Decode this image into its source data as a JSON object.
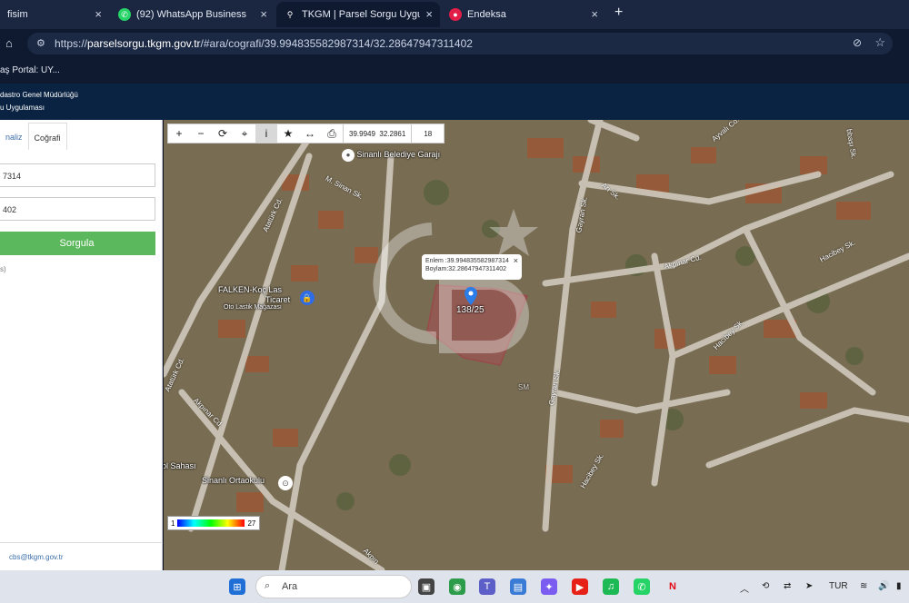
{
  "browser": {
    "tabs": [
      {
        "title": "fisim"
      },
      {
        "title": "(92) WhatsApp Business"
      },
      {
        "title": "TKGM | Parsel Sorgu Uygulamas"
      },
      {
        "title": "Endeksa"
      }
    ],
    "url_prefix": "https://",
    "url_host": "parselsorgu.tkgm.gov.tr",
    "url_path": "/#ara/cografi/39.994835582987314/32.28647947311402",
    "bookmark": "aş Portal: UY..."
  },
  "site": {
    "org": "dastro Genel Müdürlüğü",
    "app": "u Uygulaması"
  },
  "panel": {
    "tabs": [
      "naliz",
      "Coğrafi"
    ],
    "lat_value": "7314",
    "lon_value": "402",
    "query_label": "Sorgula",
    "small_note": "s)",
    "footer_email": "cbs@tkgm.gov.tr"
  },
  "map": {
    "toolbar": {
      "lat": "39.9949",
      "lon": "32.2861",
      "zoom": "18"
    },
    "popup_lat": "Enlem :39.994835582987314",
    "popup_lon": "Boylam:32.28647947311402",
    "parcel_label": "138/25",
    "poi": [
      {
        "name": "Sinanlı Belediye Garajı"
      },
      {
        "name": "FALKEN-Koç Las"
      },
      {
        "name": "Ticaret"
      },
      {
        "name": "Oto Lastik Mağazası"
      },
      {
        "name": "Sinanlı Ortaokulu"
      },
      {
        "name": "ol Sahası"
      }
    ],
    "roads": [
      "M. Sinan Sk.",
      "Atatürk Cd.",
      "Gayran Sk.",
      "Arı Sk.",
      "Ayvalı Cd.",
      "Akpınar Cd.",
      "Hacibey Sk.",
      "Hacıbey Sk.",
      "Gayran Sk.",
      "Akpınar Cd.",
      "Akpın",
      "Hacibey Sk.",
      "Atatürk Cd.",
      "bbaşı Sk."
    ],
    "watermark_letters": "SM",
    "legend_min": "1",
    "legend_max": "27"
  },
  "taskbar": {
    "search_placeholder": "Ara",
    "lang": "TUR"
  },
  "colors": {
    "accent_green": "#5cb85c",
    "parcel_outline": "#d0103a",
    "header_bg": "#0a2342"
  }
}
